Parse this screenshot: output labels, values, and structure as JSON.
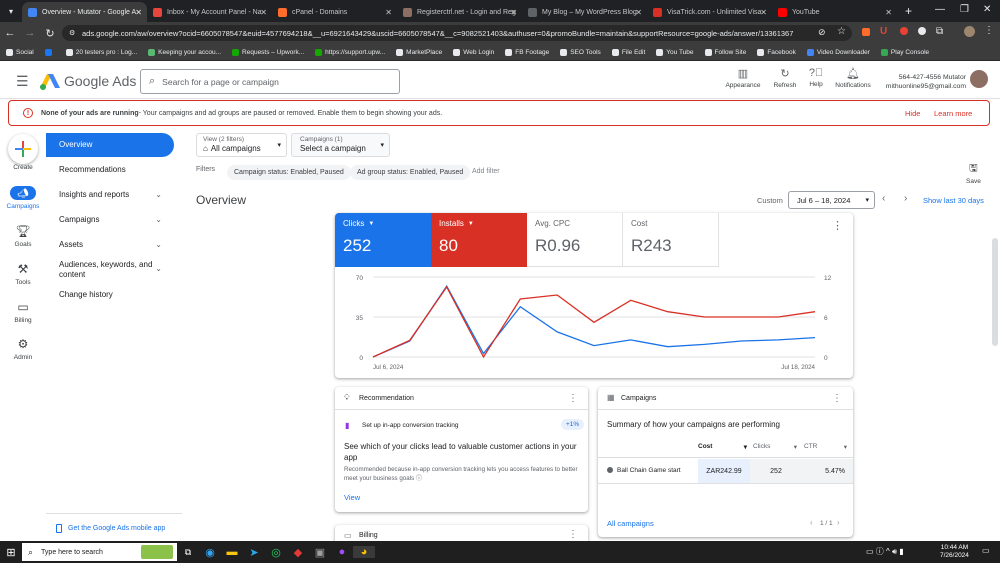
{
  "browser": {
    "tabs": [
      {
        "label": "Overview - Mutator - Google A",
        "color": "#4285f4"
      },
      {
        "label": "Inbox - My Account Panel - Na",
        "color": "#e8453c"
      },
      {
        "label": "cPanel - Domains",
        "color": "#ff6c2c"
      },
      {
        "label": "Registerctrl.net - Login and Reg",
        "color": "#8d6e63"
      },
      {
        "label": "My Blog – My WordPress Blog",
        "color": "#5f6368"
      },
      {
        "label": "VisaTrick.com - Unlimited Visa",
        "color": "#d93025"
      },
      {
        "label": "YouTube",
        "color": "#ff0000"
      }
    ],
    "new_tab": "+",
    "url": "ads.google.com/aw/overview?ocid=6605078547&euid=4577694218&__u=6921643429&uscid=6605078547&__c=9082521403&authuser=0&promoBundle=maintain&supportResource=google-ads/answer/13361367",
    "bookmarks": [
      "Social",
      "",
      "20 testers pro : Log...",
      "Keeping your accou...",
      "Requests – Upwork...",
      "https://support.upw...",
      "MarketPlace",
      "Web Login",
      "FB Footage",
      "SEO Tools",
      "File Edit",
      "You Tube",
      "Follow Site",
      "Facebook",
      "Video Downloader",
      "Play Console"
    ]
  },
  "header": {
    "product": "Google Ads",
    "search_placeholder": "Search for a page or campaign",
    "appearance": "Appearance",
    "refresh": "Refresh",
    "help": "Help",
    "notifications": "Notifications",
    "account_id": "564-427-4556 Mutator",
    "account_email": "mithuonline95@gmail.com"
  },
  "alert": {
    "bold": "None of your ads are running",
    "text": " - Your campaigns and ad groups are paused or removed. Enable them to begin showing your ads.",
    "hide": "Hide",
    "learn": "Learn more"
  },
  "rail": {
    "create": "Create",
    "campaigns": "Campaigns",
    "goals": "Goals",
    "tools": "Tools",
    "billing": "Billing",
    "admin": "Admin"
  },
  "nav": {
    "overview": "Overview",
    "recommendations": "Recommendations",
    "insights": "Insights and reports",
    "campaigns": "Campaigns",
    "assets": "Assets",
    "audiences_1": "Audiences, keywords, and",
    "audiences_2": "content",
    "history": "Change history",
    "mobile_app": "Get the Google Ads mobile app"
  },
  "filters": {
    "view_label": "View (2 filters)",
    "view_value": "All campaigns",
    "camp_label": "Campaigns (1)",
    "camp_value": "Select a campaign",
    "filters_label": "Filters",
    "chip1": "Campaign status: Enabled, Paused",
    "chip2": "Ad group status: Enabled, Paused",
    "add": "Add filter",
    "save": "Save"
  },
  "overview": {
    "title": "Overview",
    "range_label": "Custom",
    "range_value": "Jul 6 – 18, 2024",
    "show_last": "Show last 30 days",
    "metrics": [
      {
        "label": "Clicks",
        "value": "252",
        "color": "#1a73e8"
      },
      {
        "label": "Installs",
        "value": "80",
        "color": "#d93025"
      },
      {
        "label": "Avg. CPC",
        "value": "R0.96"
      },
      {
        "label": "Cost",
        "value": "R243"
      }
    ]
  },
  "chart_data": {
    "type": "line",
    "x_start": "Jul 6, 2024",
    "x_end": "Jul 18, 2024",
    "left_ticks": [
      "70",
      "35",
      "0"
    ],
    "right_ticks": [
      "12",
      "6",
      "0"
    ],
    "ylim_left": [
      0,
      70
    ],
    "ylim_right": [
      0,
      12
    ],
    "series": [
      {
        "name": "Clicks",
        "axis": "left",
        "color": "#1a73e8",
        "values": [
          0,
          14,
          62,
          3,
          44,
          22,
          10,
          15,
          9,
          11,
          14,
          15,
          17
        ]
      },
      {
        "name": "Installs",
        "axis": "right",
        "color": "#d93025",
        "values": [
          0,
          2.5,
          10.5,
          0,
          8.7,
          9.3,
          5.2,
          8.5,
          6.8,
          6,
          6,
          6,
          6.8
        ]
      }
    ]
  },
  "recommendation": {
    "title": "Recommendation",
    "item": "Set up in-app conversion tracking",
    "badge": "+1%",
    "headline": "See which of your clicks lead to valuable customer actions in your app",
    "body": "Recommended because in-app conversion tracking lets you access features to better meet your business goals",
    "view": "View"
  },
  "campaigns_card": {
    "title": "Campaigns",
    "summary": "Summary of how your campaigns are performing",
    "columns": [
      "Cost",
      "Clicks",
      "CTR"
    ],
    "row": {
      "name": "Ball Chain Game start",
      "cost": "ZAR242.99",
      "clicks": "252",
      "ctr": "5.47%"
    },
    "all": "All campaigns",
    "pager": "1 / 1"
  },
  "billing_card": {
    "title": "Billing"
  },
  "taskbar": {
    "search": "Type here to search",
    "time": "10:44 AM",
    "date": "7/26/2024"
  }
}
